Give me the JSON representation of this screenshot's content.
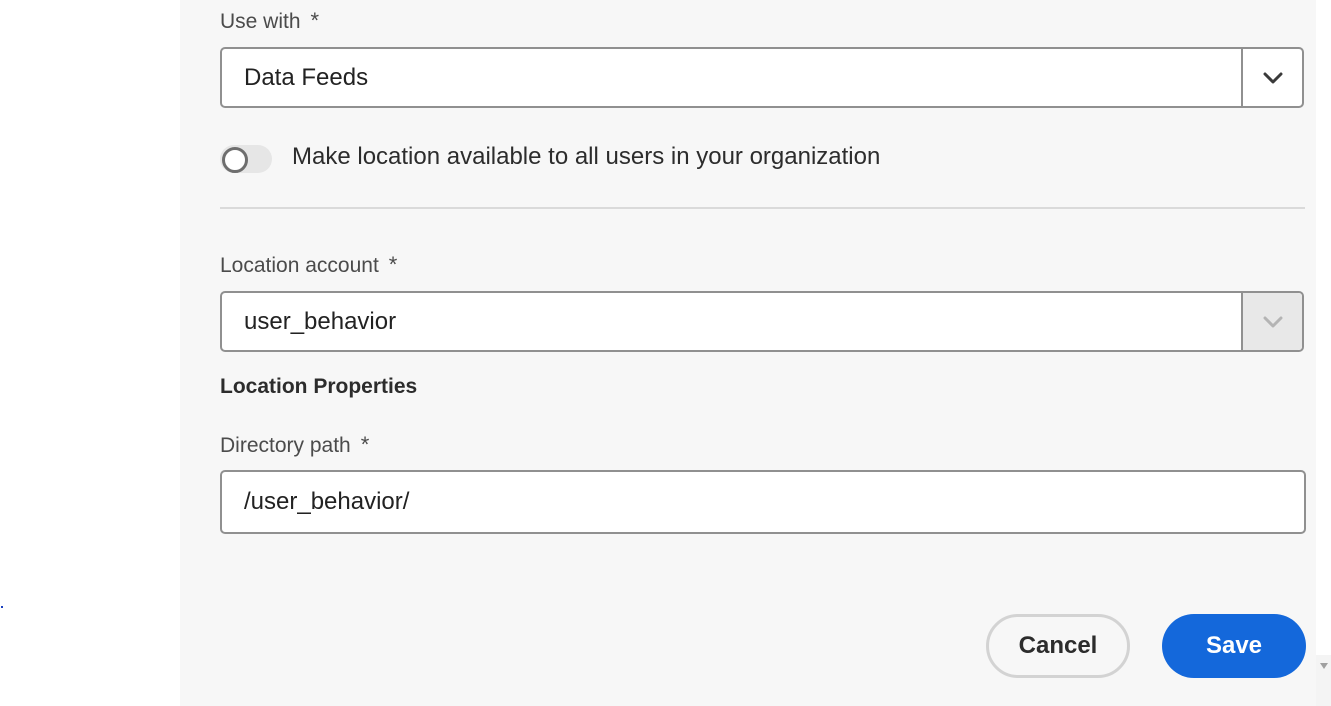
{
  "form": {
    "use_with": {
      "label": "Use with",
      "required_mark": "*",
      "value": "Data Feeds",
      "icon": "chevron-down-icon"
    },
    "share_toggle": {
      "label": "Make location available to all users in your organization",
      "state": "off"
    },
    "location_account": {
      "label": "Location account",
      "required_mark": "*",
      "value": "user_behavior",
      "icon": "chevron-down-icon"
    },
    "location_properties": {
      "heading": "Location Properties"
    },
    "directory_path": {
      "label": "Directory path",
      "required_mark": "*",
      "value": "/user_behavior/"
    }
  },
  "actions": {
    "cancel_label": "Cancel",
    "save_label": "Save"
  },
  "colors": {
    "primary": "#1468db",
    "panel_bg": "#f7f7f7"
  }
}
